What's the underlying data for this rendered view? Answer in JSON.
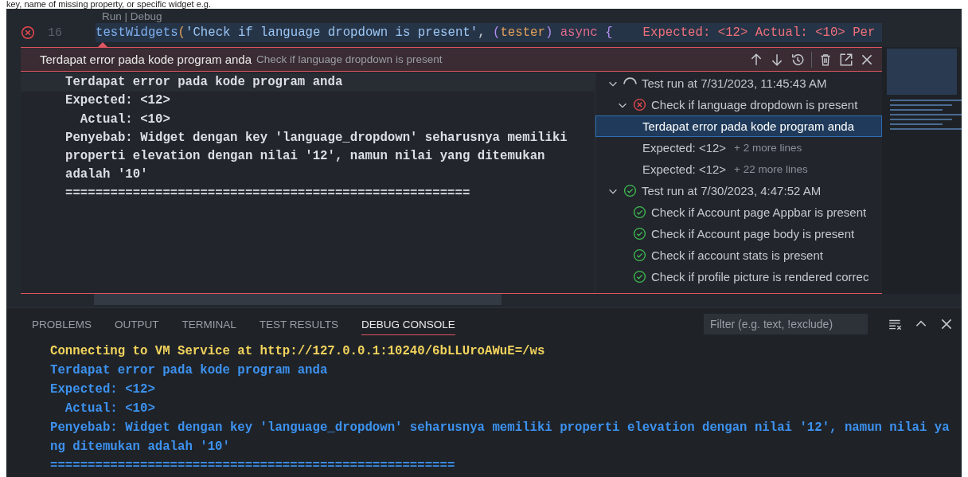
{
  "top_caption": "key, name of missing property, or specific widget e.g.",
  "editor": {
    "codelens": "Run | Debug",
    "line_number": "16",
    "has_error": true,
    "tokens": [
      {
        "kind": "function",
        "text": "testWidgets"
      },
      {
        "kind": "bracket",
        "text": "("
      },
      {
        "kind": "string",
        "text": "'Check if language dropdown is present'"
      },
      {
        "kind": "plain",
        "text": ", "
      },
      {
        "kind": "paren",
        "text": "("
      },
      {
        "kind": "param",
        "text": "tester"
      },
      {
        "kind": "paren",
        "text": ") "
      },
      {
        "kind": "keyword",
        "text": "async "
      },
      {
        "kind": "paren",
        "text": "{"
      }
    ],
    "inline_error": "Expected: <12> Actual: <10> Per"
  },
  "peek": {
    "title": "Terdapat error pada kode program anda",
    "subtitle": "Check if language dropdown is present",
    "actions": [
      {
        "kind": "up"
      },
      {
        "kind": "down"
      },
      {
        "kind": "history"
      },
      {
        "kind": "divider"
      },
      {
        "kind": "delete"
      },
      {
        "kind": "open"
      },
      {
        "kind": "close"
      }
    ],
    "message_lines": [
      "Terdapat error pada kode program anda",
      "Expected: <12>",
      "  Actual: <10>",
      "Penyebab: Widget dengan key 'language_dropdown' seharusnya memiliki properti elevation dengan nilai '12', namun nilai yang ditemukan adalah '10'",
      "======================================================"
    ],
    "tree": [
      {
        "label": "Test run at 7/31/2023, 11:45:43 AM",
        "kind": "running",
        "expanded": true,
        "selected": false,
        "children": [
          {
            "label": "Check if language dropdown is present",
            "kind": "failed",
            "expanded": true,
            "selected": false,
            "children": [
              {
                "label": "Terdapat error pada kode program anda",
                "selected": true
              },
              {
                "label": "Expected: <12>",
                "more": "+ 2 more lines",
                "selected": false
              },
              {
                "label": "Expected: <12>",
                "more": "+ 22 more lines",
                "selected": false
              }
            ]
          }
        ]
      },
      {
        "label": "Test run at 7/30/2023, 4:47:52 AM",
        "kind": "passed",
        "expanded": true,
        "selected": false,
        "children": [
          {
            "label": "Check if Account page Appbar is present",
            "kind": "passed",
            "selected": false
          },
          {
            "label": "Check if Account page body is present",
            "kind": "passed",
            "selected": false
          },
          {
            "label": "Check if account stats is present",
            "kind": "passed",
            "selected": false
          },
          {
            "label": "Check if profile picture is rendered correc",
            "kind": "passed",
            "selected": false
          }
        ]
      }
    ]
  },
  "panel": {
    "tabs": [
      {
        "label": "PROBLEMS",
        "selected": false
      },
      {
        "label": "OUTPUT",
        "selected": false
      },
      {
        "label": "TERMINAL",
        "selected": false
      },
      {
        "label": "TEST RESULTS",
        "selected": false
      },
      {
        "label": "DEBUG CONSOLE",
        "selected": true
      }
    ],
    "filter": {
      "placeholder": "Filter (e.g. text, !exclude)"
    },
    "console": [
      {
        "kind": "info",
        "text": "Connecting to VM Service at http://127.0.0.1:10240/6bLLUroAWuE=/ws"
      },
      {
        "kind": "output",
        "text": "Terdapat error pada kode program anda"
      },
      {
        "kind": "output",
        "text": "Expected: <12>"
      },
      {
        "kind": "output",
        "text": "  Actual: <10>"
      },
      {
        "kind": "output",
        "text": "Penyebab: Widget dengan key 'language_dropdown' seharusnya memiliki properti elevation dengan nilai '12', namun nilai yang ditemukan adalah '10'"
      },
      {
        "kind": "output",
        "text": "======================================================"
      }
    ]
  }
}
